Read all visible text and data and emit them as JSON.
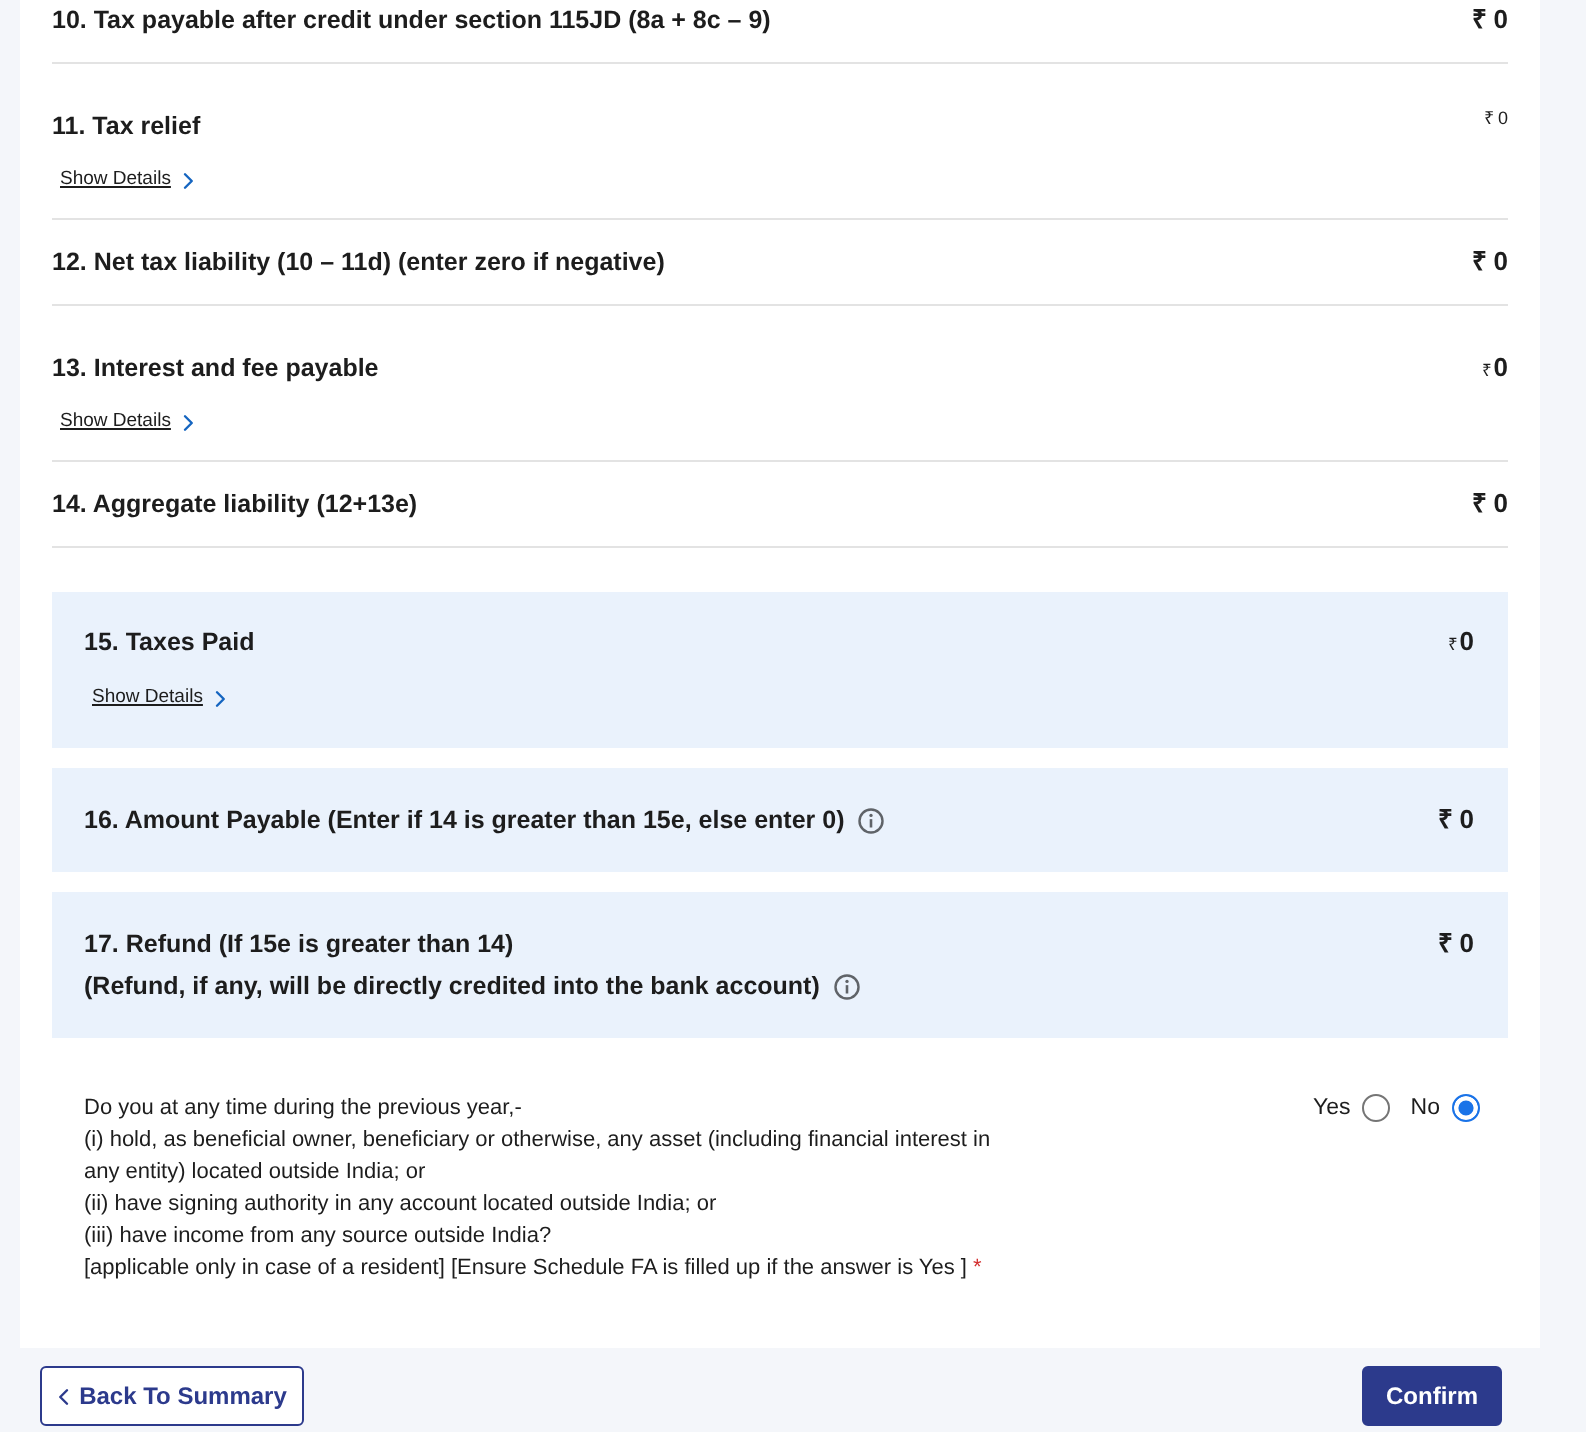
{
  "rows": [
    {
      "kind": "line",
      "label": "10. Tax payable after credit under section 115JD (8a + 8c – 9)",
      "value": {
        "kind": "bold",
        "currency": "₹",
        "amount": "0"
      },
      "info": false
    },
    {
      "kind": "line",
      "label": "11. Tax relief",
      "value": {
        "kind": "small",
        "currency": "₹",
        "amount": "0"
      },
      "info": false,
      "link": "Show Details"
    },
    {
      "kind": "line",
      "label": "12. Net tax liability (10 – 11d) (enter zero if negative)",
      "value": {
        "kind": "bold",
        "currency": "₹",
        "amount": "0"
      },
      "info": false
    },
    {
      "kind": "line",
      "label": "13. Interest and fee payable",
      "value": {
        "kind": "mixed",
        "currency": "₹",
        "amount": "0"
      },
      "info": false,
      "link": "Show Details"
    },
    {
      "kind": "line",
      "label": "14. Aggregate liability (12+13e)",
      "value": {
        "kind": "bold",
        "currency": "₹",
        "amount": "0"
      },
      "info": false
    },
    {
      "kind": "panel",
      "label": "15. Taxes Paid",
      "value": {
        "kind": "mixed",
        "currency": "₹",
        "amount": "0"
      },
      "info": false,
      "link": "Show Details"
    },
    {
      "kind": "panel",
      "label": "16. Amount Payable (Enter if 14 is greater than 15e, else enter 0)",
      "value": {
        "kind": "bold",
        "currency": "₹",
        "amount": "0"
      },
      "info": true
    },
    {
      "kind": "panel",
      "label": "17. Refund (If 15e is greater than 14)",
      "note": "(Refund, if any, will be directly credited into the bank account)",
      "value": {
        "kind": "bold",
        "currency": "₹",
        "amount": "0"
      },
      "info": true
    }
  ],
  "question": {
    "lines": [
      "Do you at any time during the previous year,-",
      "(i) hold, as beneficial owner, beneficiary or otherwise, any asset (including financial interest in any entity) located outside India; or",
      "(ii) have signing authority in any account located outside India; or",
      "(iii) have income from any source outside India?",
      "[applicable only in case of a resident] [Ensure Schedule FA is filled up if the answer is Yes ]"
    ],
    "required_mark": "*",
    "options": [
      {
        "label": "Yes",
        "selected": false
      },
      {
        "label": "No",
        "selected": true
      }
    ]
  },
  "buttons": [
    {
      "kind": "back",
      "label": "Back To Summary"
    },
    {
      "kind": "confirm",
      "label": "Confirm"
    }
  ]
}
